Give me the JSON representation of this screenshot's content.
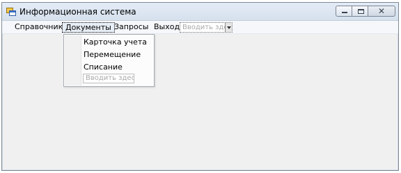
{
  "window": {
    "title": "Информационная система",
    "app_icon": "app-form-icon",
    "controls": {
      "minimize_icon": "minimize-icon",
      "maximize_icon": "maximize-icon",
      "close_icon": "close-icon",
      "close_glyph": "✕"
    }
  },
  "menubar": {
    "items": [
      {
        "label": "Справочники"
      },
      {
        "label": "Документы",
        "active": true
      },
      {
        "label": "Запросы"
      },
      {
        "label": "Выход"
      }
    ],
    "type_here": "Вводить здесь"
  },
  "dropdown": {
    "items": [
      {
        "label": "Карточка учета"
      },
      {
        "label": "Перемещение"
      },
      {
        "label": "Списание"
      }
    ],
    "type_here": "Вводить здесь"
  },
  "colors": {
    "titlebar": "#d6e1ee",
    "client_area": "#f0f0f0",
    "menubar": "#f5f7fa"
  }
}
